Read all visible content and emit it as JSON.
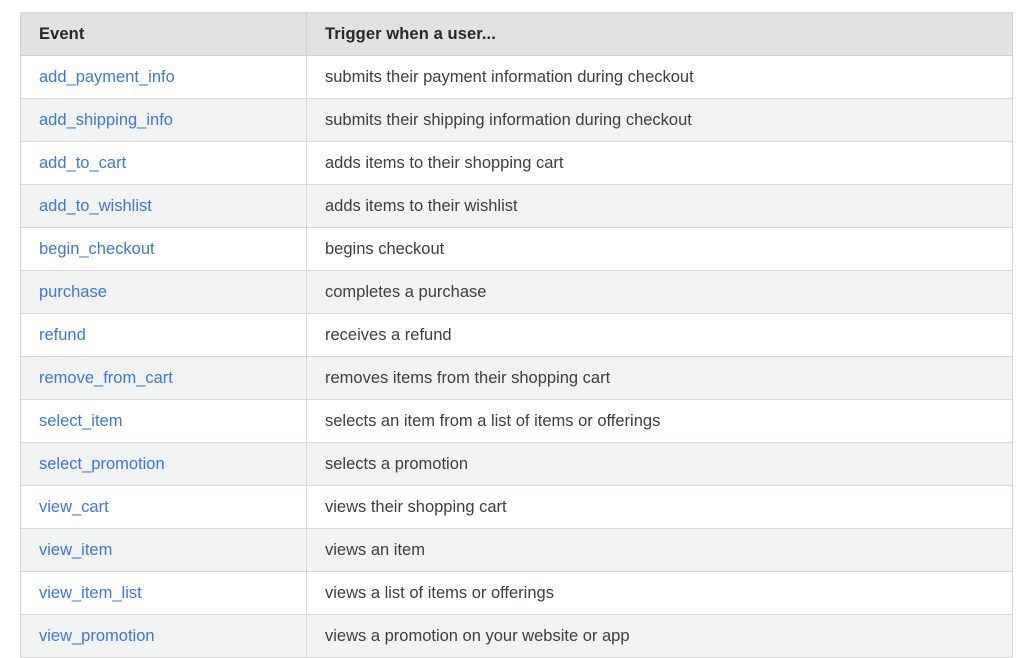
{
  "table": {
    "columns": [
      {
        "key": "event",
        "label": "Event"
      },
      {
        "key": "trigger",
        "label": "Trigger when a user..."
      }
    ],
    "link_color": "#3d77e3",
    "header_background": "#e1e1e1",
    "stripe_background": "#f1f2f2",
    "row_background": "#ffffff",
    "border_color": "#d8d8d8",
    "text_color": "#3b4043",
    "rows": [
      {
        "event": "add_payment_info",
        "trigger": "submits their payment information during checkout"
      },
      {
        "event": "add_shipping_info",
        "trigger": "submits their shipping information during checkout"
      },
      {
        "event": "add_to_cart",
        "trigger": "adds items to their shopping cart"
      },
      {
        "event": "add_to_wishlist",
        "trigger": "adds items to their wishlist"
      },
      {
        "event": "begin_checkout",
        "trigger": "begins checkout"
      },
      {
        "event": "purchase",
        "trigger": "completes a purchase"
      },
      {
        "event": "refund",
        "trigger": "receives a refund"
      },
      {
        "event": "remove_from_cart",
        "trigger": "removes items from their shopping cart"
      },
      {
        "event": "select_item",
        "trigger": "selects an item from a list of items or offerings"
      },
      {
        "event": "select_promotion",
        "trigger": "selects a promotion"
      },
      {
        "event": "view_cart",
        "trigger": "views their shopping cart"
      },
      {
        "event": "view_item",
        "trigger": "views an item"
      },
      {
        "event": "view_item_list",
        "trigger": "views a list of items or offerings"
      },
      {
        "event": "view_promotion",
        "trigger": "views a promotion on your website or app"
      }
    ]
  }
}
